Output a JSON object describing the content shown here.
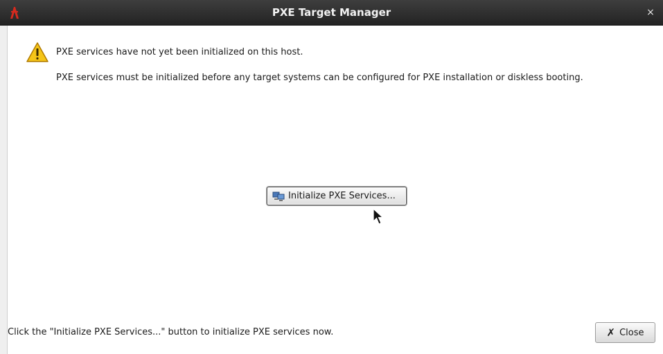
{
  "window": {
    "title": "PXE Target Manager",
    "close_glyph": "×"
  },
  "message": {
    "icon": "warning-icon",
    "line1": "PXE services have not yet been initialized on this host.",
    "line2": "PXE services must be initialized before any target systems can be configured for PXE installation or diskless booting."
  },
  "init_button": {
    "label": "Initialize PXE Services...",
    "icon": "network-computers-icon"
  },
  "footer": {
    "hint": "Click the \"Initialize PXE Services...\" button to initialize PXE services now.",
    "close_label": "Close",
    "close_icon": "close-icon",
    "close_glyph": "✗"
  }
}
